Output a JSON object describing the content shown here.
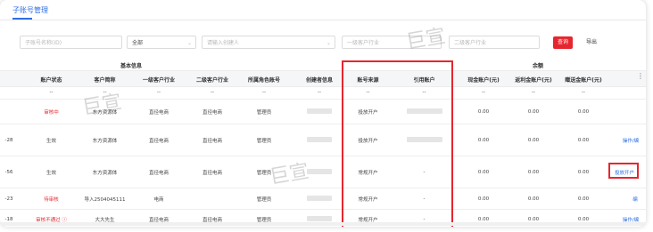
{
  "tab": {
    "label": "子账号管理"
  },
  "filters": {
    "sub_account_name": "子账号名称(ID)",
    "status": "全部",
    "employee": "请输入创建人",
    "primary_industry": "一级客户行业",
    "secondary_industry": "二级客户行业",
    "query_label": "查询",
    "export_label": "导出"
  },
  "table": {
    "group_basic": "基本信息",
    "group_balance": "余额",
    "headers": [
      "账户状态",
      "客户简称",
      "一级客户行业",
      "二级客户行业",
      "所属角色账号",
      "创建者信息",
      "账号来源",
      "引用账户",
      "现金账户(元)",
      "返利金账户(元)",
      "赠送金账户(元)"
    ],
    "filter_row": [
      "--",
      "--",
      "--",
      "--",
      "--",
      "--",
      "--",
      "--",
      "--",
      "--",
      "--"
    ],
    "rows": [
      {
        "id": "",
        "status": "审核中",
        "status_color": "red",
        "customer": "东方资源体",
        "ind1": "直径电商",
        "ind2": "直径电商",
        "role": "管理员",
        "source": "投放开户",
        "ref": "",
        "cash": "0.00",
        "rebate": "0.00",
        "gift": "0.00",
        "action": ""
      },
      {
        "id": "-28",
        "status": "生效",
        "status_color": "normal",
        "customer": "东方资源体",
        "ind1": "直径电商",
        "ind2": "直径电商",
        "role": "管理员",
        "source": "投放开户",
        "ref": "",
        "cash": "0.00",
        "rebate": "0.00",
        "gift": "0.00",
        "action": "操作/编"
      },
      {
        "id": "-56",
        "status": "生效",
        "status_color": "normal",
        "customer": "东方资源体",
        "ind1": "直径电商",
        "ind2": "直径电商",
        "role": "管理员",
        "source": "常规开户",
        "ref": "-",
        "cash": "0.00",
        "rebate": "0.00",
        "gift": "0.00",
        "action": "投放开户"
      },
      {
        "id": "-23",
        "status": "待审核",
        "status_color": "red",
        "customer": "导入2504045111",
        "ind1": "电商",
        "ind2": "",
        "role": "管理员",
        "source": "常规开户",
        "ref": "-",
        "cash": "0.00",
        "rebate": "0.00",
        "gift": "0.00",
        "action": "编"
      },
      {
        "id": "-18",
        "status": "审核不通过 ⓘ",
        "status_color": "red",
        "customer": "大大先生",
        "ind1": "直径电商",
        "ind2": "直径电商",
        "role": "管理员",
        "source": "常规开户",
        "ref": "-",
        "cash": "0.00",
        "rebate": "0.00",
        "gift": "0.00",
        "action": "操作/编"
      }
    ]
  },
  "watermark": "巨宣",
  "colors": {
    "accent": "#2f6fe4",
    "danger": "#e6262e"
  }
}
